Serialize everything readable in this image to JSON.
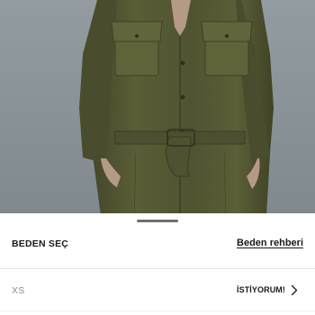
{
  "size_sheet": {
    "title": "BEDEN SEÇ",
    "size_guide_label": "Beden rehberi",
    "sizes": [
      {
        "label": "XS",
        "action_label": "İSTİYORUM!"
      }
    ]
  },
  "colors": {
    "photo_background": "#8a9499",
    "garment": "#575b35",
    "text": "#1a1a1a",
    "muted_text": "#8c8c8c"
  },
  "icons": {
    "size_row_chevron": "chevron-right-icon"
  }
}
